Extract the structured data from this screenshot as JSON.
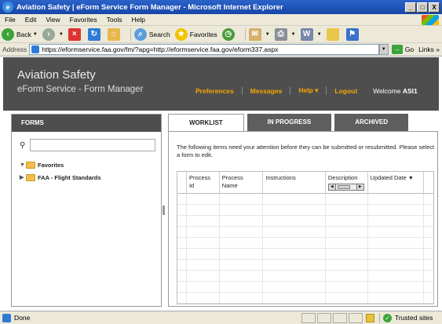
{
  "window": {
    "title": "Aviation Safety | eForm Service Form Manager - Microsoft Internet Explorer",
    "minimize": "_",
    "maximize": "□",
    "close": "X"
  },
  "menu": [
    "File",
    "Edit",
    "View",
    "Favorites",
    "Tools",
    "Help"
  ],
  "toolbar": {
    "back": "Back",
    "search": "Search",
    "favorites": "Favorites"
  },
  "address": {
    "label": "Address",
    "url": "https://eformservice.faa.gov/fm/?apg=http://eformservice.faa.gov/eform337.aspx",
    "go": "Go",
    "links": "Links »"
  },
  "header": {
    "title": "Aviation Safety",
    "subtitle": "eForm Service - Form Manager",
    "nav": [
      "Preferences",
      "Messages",
      "Help ▾",
      "Logout"
    ],
    "welcome_prefix": "Welcome",
    "welcome_user": "ASI1"
  },
  "forms_panel": {
    "title": "FORMS",
    "search_value": "",
    "tree": [
      {
        "label": "Favorites",
        "expanded": true
      },
      {
        "label": "FAA - Flight Standards",
        "expanded": false
      }
    ]
  },
  "tabs": [
    {
      "label": "WORKLIST",
      "active": true
    },
    {
      "label": "IN PROGRESS",
      "active": false
    },
    {
      "label": "ARCHIVED",
      "active": false
    }
  ],
  "worklist": {
    "message": "The following items need your attention before they can be submitted or resubmitted. Please select a form to edit.",
    "columns": [
      "Process Id",
      "Process Name",
      "Instructions",
      "Description",
      "Updated Date"
    ],
    "rows": []
  },
  "statusbar": {
    "status": "Done",
    "zone": "Trusted sites"
  },
  "colors": {
    "header_bg": "#4e4e4e",
    "nav_accent": "#f7a600",
    "title_bar": "#1746a8"
  }
}
